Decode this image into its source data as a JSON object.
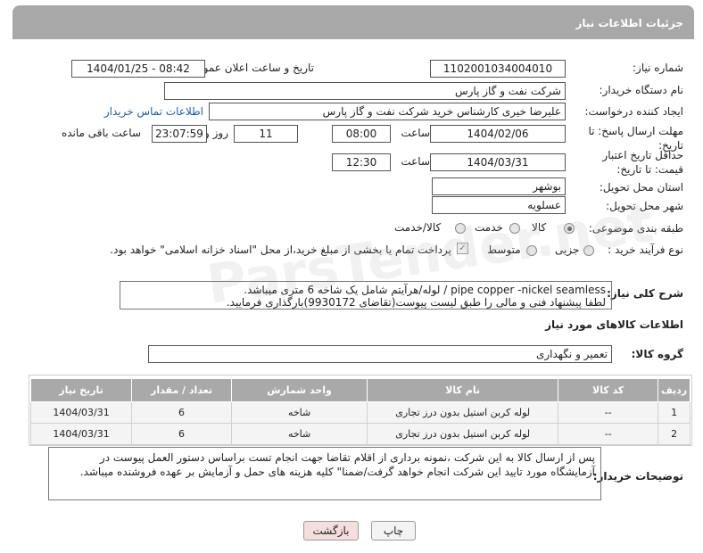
{
  "header": {
    "title": "جزئیات اطلاعات نیاز"
  },
  "form": {
    "need_number_label": "شماره نیاز:",
    "need_number": "1102001034004010",
    "announce_label": "تاریخ و ساعت اعلان عمومی:",
    "announce_value": "1404/01/25 - 08:42",
    "buyer_org_label": "نام دستگاه خریدار:",
    "buyer_org": "شرکت نفت و گاز پارس",
    "creator_label": "ایجاد کننده درخواست:",
    "creator": "علیرضا  خیری کارشناس خرید  شرکت نفت و گاز پارس",
    "contact_link": "اطلاعات تماس خریدار",
    "deadline_label": "مهلت ارسال پاسخ: تا تاریخ:",
    "deadline_date": "1404/02/06",
    "time_label": "ساعت",
    "deadline_time": "08:00",
    "days_value": "11",
    "days_label": "روز و",
    "remaining_time": "23:07:59",
    "remaining_label": "ساعت باقی مانده",
    "validity_label": "حداقل تاریخ اعتبار قیمت: تا تاریخ:",
    "validity_date": "1404/03/31",
    "validity_time": "12:30",
    "province_label": "استان محل تحویل:",
    "province": "بوشهر",
    "city_label": "شهر محل تحویل:",
    "city": "عسلویه",
    "category_label": "طبقه بندی موضوعی:",
    "category_options": [
      "کالا",
      "خدمت",
      "کالا/خدمت"
    ],
    "category_selected": "کالا",
    "process_label": "نوع فرآیند خرید :",
    "process_options": [
      "جزیی",
      "متوسط"
    ],
    "process_note": "پرداخت تمام یا بخشی از مبلغ خرید،از محل \"اسناد خزانه اسلامی\" خواهد بود."
  },
  "description": {
    "label": "شرح کلی نیاز:",
    "line1": "pipe copper -nickel seamless / لوله/هرآیتم  شامل یک شاخه 6 متری میباشد.",
    "line2": "لطفا پیشنهاد فنی و مالی را طبق لیست پیوست(تقاضای 9930172)بارگذاری فرمایید."
  },
  "goods": {
    "section_title": "اطلاعات کالاهای مورد نیاز",
    "group_label": "گروه کالا:",
    "group_value": "تعمیر و نگهداری",
    "columns": [
      "ردیف",
      "کد کالا",
      "نام کالا",
      "واحد شمارش",
      "تعداد / مقدار",
      "تاریخ نیاز"
    ],
    "rows": [
      [
        "1",
        "--",
        "لوله کربن استیل بدون درز تجاری",
        "شاخه",
        "6",
        "1404/03/31"
      ],
      [
        "2",
        "--",
        "لوله کربن استیل بدون درز تجاری",
        "شاخه",
        "6",
        "1404/03/31"
      ]
    ]
  },
  "buyer_notes": {
    "label": "توضیحات خریدار:",
    "text": "پس از ارسال کالا به این شرکت ،نمونه برداری از اقلام تقاضا جهت انجام تست  براساس دستور العمل پیوست در آزمایشگاه مورد تایید این شرکت انجام خواهد گرفت/ضمنا\" کلیه هزینه های حمل و آزمایش بر عهده فروشنده میباشد."
  },
  "buttons": {
    "print": "چاپ",
    "back": "بازگشت"
  },
  "watermark": "ParsTender.net"
}
